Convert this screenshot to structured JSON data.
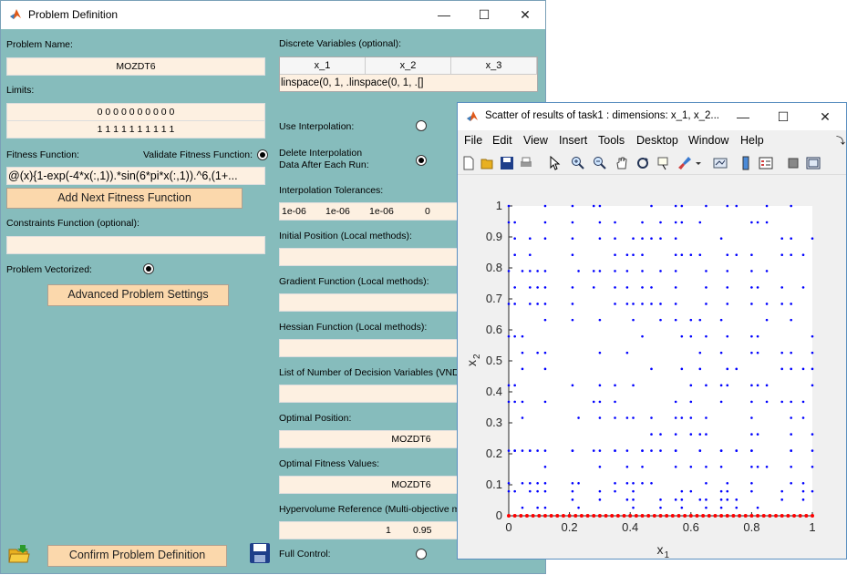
{
  "problem_window": {
    "title": "Problem Definition",
    "problem_name_label": "Problem Name:",
    "problem_name_value": "MOZDT6",
    "limits_label": "Limits:",
    "limits_lower": "0  0  0  0  0  0  0  0  0  0",
    "limits_upper": "1  1  1  1  1  1  1  1  1  1",
    "fitness_label": "Fitness Function:",
    "validate_label": "Validate Fitness Function:",
    "fitness_value": "@(x){1-exp(-4*x(:,1)).*sin(6*pi*x(:,1)).^6,(1+...",
    "add_fitness_button": "Add Next Fitness Function",
    "constraints_label": "Constraints Function (optional):",
    "constraints_value": "",
    "vectorized_label": "Problem Vectorized:",
    "advanced_button": "Advanced Problem Settings",
    "confirm_button": "Confirm Problem Definition",
    "discrete_label": "Discrete Variables (optional):",
    "discrete_headers": [
      "x_1",
      "x_2",
      "x_3"
    ],
    "discrete_values": [
      "linspace(0, 1, ...",
      "linspace(0, 1, ...",
      "[]"
    ],
    "use_interp_label": "Use Interpolation:",
    "delete_interp_label_1": "Delete Interpolation",
    "delete_interp_label_2": "Data After Each Run:",
    "interp_tol_label": "Interpolation Tolerances:",
    "interp_tol_values": [
      "1e-06",
      "1e-06",
      "1e-06",
      "0"
    ],
    "initial_pos_label": "Initial Position (Local methods):",
    "gradient_label": "Gradient Function (Local methods):",
    "hessian_label": "Hessian Function (Local methods):",
    "num_dec_label": "List of Number of Decision Variables (VND",
    "optimal_pos_label": "Optimal Position:",
    "optimal_pos_value": "MOZDT6",
    "optimal_fit_label": "Optimal Fitness Values:",
    "optimal_fit_value": "MOZDT6",
    "hypervolume_label": "Hypervolume Reference (Multi-objective me",
    "hypervolume_values": [
      "1",
      "0.95"
    ],
    "full_control_label": "Full Control:"
  },
  "figure_window": {
    "title": "Scatter of results of task1 : dimensions:  x_1, x_2...",
    "menu": [
      "File",
      "Edit",
      "View",
      "Insert",
      "Tools",
      "Desktop",
      "Window",
      "Help"
    ]
  },
  "colors": {
    "panel": "#86bcbc",
    "field": "#fdf0e1",
    "button": "#fbd8ac",
    "blue_points": "#0000ff",
    "red_points": "#ff0000"
  },
  "chart_data": {
    "type": "scatter",
    "xlabel": "x",
    "xlabel_sub": "1",
    "ylabel": "x",
    "ylabel_sub": "2",
    "xlim": [
      0,
      1
    ],
    "ylim": [
      0,
      1
    ],
    "xticks": [
      "0",
      "0.2",
      "0.4",
      "0.6",
      "0.8",
      "1"
    ],
    "yticks": [
      "0",
      "0.1",
      "0.2",
      "0.3",
      "0.4",
      "0.5",
      "0.6",
      "0.7",
      "0.8",
      "0.9",
      "1"
    ],
    "grid": false,
    "series": [
      {
        "color": "#0000ff",
        "x": [
          0.0,
          0.0,
          0.0,
          0.0,
          0.0,
          0.0,
          0.0,
          0.0,
          0.0,
          0.0,
          0.0,
          0.0,
          0.0,
          0.0,
          0.0,
          0.0,
          0.0,
          0.0,
          0.0,
          0.0,
          0.0,
          0.0,
          0.0,
          0.0,
          0.0,
          0.0,
          0.0,
          0.0,
          0.0,
          0.0,
          0.0,
          0.0,
          0.0,
          0.0,
          0.0,
          0.0,
          0.0,
          0.0,
          0.0,
          0.0,
          0.0,
          0.0,
          0.0,
          0.0,
          0.0,
          0.0,
          0.0,
          0.0,
          0.0,
          0.0
        ],
        "y": [
          0.0,
          0.0,
          0.0,
          0.0,
          0.0,
          0.0,
          0.0,
          0.0,
          0.0,
          0.0,
          0.0,
          0.0,
          0.0,
          0.0,
          0.0,
          0.0,
          0.0,
          0.0,
          0.0,
          0.0,
          0.0,
          0.0,
          0.0,
          0.0,
          0.0,
          0.0,
          0.0,
          0.0,
          0.0,
          0.0,
          0.0,
          0.0,
          0.0,
          0.0,
          0.0,
          0.0,
          0.0,
          0.0,
          0.0,
          0.0,
          0.0,
          0.0,
          0.0,
          0.0,
          0.0,
          0.0,
          0.0,
          0.0,
          0.0,
          0.0
        ]
      },
      {
        "color": "#ff0000",
        "x": [
          0.0,
          0.02,
          0.04,
          0.06,
          0.08,
          0.1,
          0.12,
          0.14,
          0.16,
          0.18,
          0.2,
          0.22,
          0.24,
          0.26,
          0.28,
          0.3,
          0.32,
          0.34,
          0.36,
          0.38,
          0.4,
          0.42,
          0.44,
          0.46,
          0.48,
          0.5,
          0.52,
          0.54,
          0.56,
          0.58,
          0.6,
          0.62,
          0.64,
          0.66,
          0.68,
          0.7,
          0.72,
          0.74,
          0.76,
          0.78,
          0.8,
          0.82,
          0.84,
          0.86,
          0.88,
          0.9,
          0.92,
          0.94,
          0.96,
          0.98,
          1.0
        ],
        "y": [
          0,
          0,
          0,
          0,
          0,
          0,
          0,
          0,
          0,
          0,
          0,
          0,
          0,
          0,
          0,
          0,
          0,
          0,
          0,
          0,
          0,
          0,
          0,
          0,
          0,
          0,
          0,
          0,
          0,
          0,
          0,
          0,
          0,
          0,
          0,
          0,
          0,
          0,
          0,
          0,
          0,
          0,
          0,
          0,
          0,
          0,
          0,
          0,
          0,
          0,
          0
        ]
      }
    ]
  }
}
